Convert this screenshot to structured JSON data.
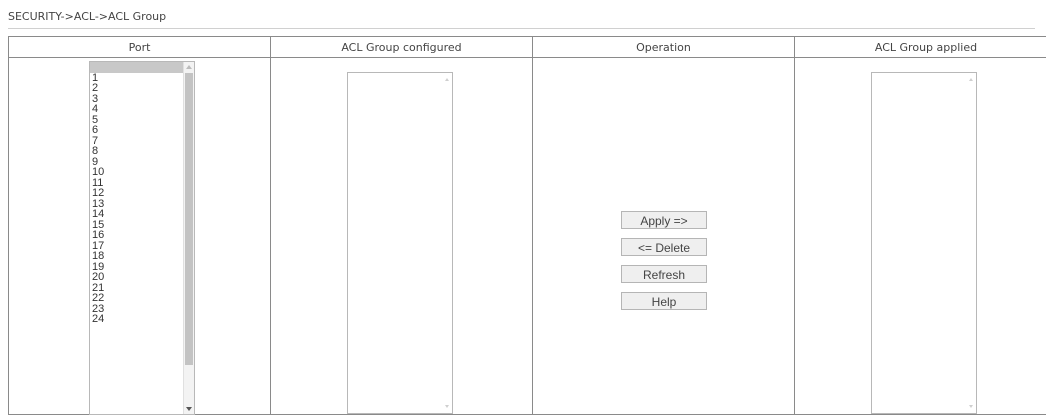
{
  "breadcrumb": "SECURITY->ACL->ACL Group",
  "table": {
    "headers": [
      "Port",
      "ACL Group configured",
      "Operation",
      "ACL Group applied"
    ]
  },
  "port_list": {
    "items": [
      "",
      "1",
      "2",
      "3",
      "4",
      "5",
      "6",
      "7",
      "8",
      "9",
      "10",
      "11",
      "12",
      "13",
      "14",
      "15",
      "16",
      "17",
      "18",
      "19",
      "20",
      "21",
      "22",
      "23",
      "24"
    ],
    "selected_index": 0
  },
  "acl_configured": {
    "items": []
  },
  "acl_applied": {
    "items": []
  },
  "operation": {
    "apply_label": "Apply =>",
    "delete_label": "<= Delete",
    "refresh_label": "Refresh",
    "help_label": "Help"
  },
  "colors": {
    "border": "#8a8a8a",
    "selected_row": "#c8c8c8",
    "button_bg": "#efefef"
  }
}
